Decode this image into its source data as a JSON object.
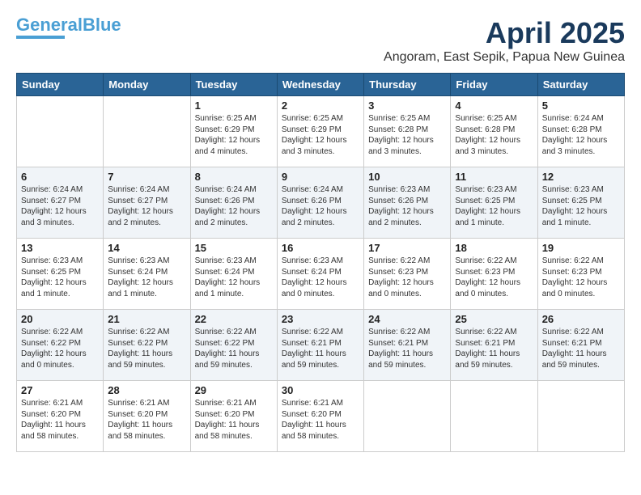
{
  "header": {
    "logo_line1": "General",
    "logo_line2": "Blue",
    "month": "April 2025",
    "location": "Angoram, East Sepik, Papua New Guinea"
  },
  "days_of_week": [
    "Sunday",
    "Monday",
    "Tuesday",
    "Wednesday",
    "Thursday",
    "Friday",
    "Saturday"
  ],
  "weeks": [
    [
      {
        "day": "",
        "content": ""
      },
      {
        "day": "",
        "content": ""
      },
      {
        "day": "1",
        "content": "Sunrise: 6:25 AM\nSunset: 6:29 PM\nDaylight: 12 hours\nand 4 minutes."
      },
      {
        "day": "2",
        "content": "Sunrise: 6:25 AM\nSunset: 6:29 PM\nDaylight: 12 hours\nand 3 minutes."
      },
      {
        "day": "3",
        "content": "Sunrise: 6:25 AM\nSunset: 6:28 PM\nDaylight: 12 hours\nand 3 minutes."
      },
      {
        "day": "4",
        "content": "Sunrise: 6:25 AM\nSunset: 6:28 PM\nDaylight: 12 hours\nand 3 minutes."
      },
      {
        "day": "5",
        "content": "Sunrise: 6:24 AM\nSunset: 6:28 PM\nDaylight: 12 hours\nand 3 minutes."
      }
    ],
    [
      {
        "day": "6",
        "content": "Sunrise: 6:24 AM\nSunset: 6:27 PM\nDaylight: 12 hours\nand 3 minutes."
      },
      {
        "day": "7",
        "content": "Sunrise: 6:24 AM\nSunset: 6:27 PM\nDaylight: 12 hours\nand 2 minutes."
      },
      {
        "day": "8",
        "content": "Sunrise: 6:24 AM\nSunset: 6:26 PM\nDaylight: 12 hours\nand 2 minutes."
      },
      {
        "day": "9",
        "content": "Sunrise: 6:24 AM\nSunset: 6:26 PM\nDaylight: 12 hours\nand 2 minutes."
      },
      {
        "day": "10",
        "content": "Sunrise: 6:23 AM\nSunset: 6:26 PM\nDaylight: 12 hours\nand 2 minutes."
      },
      {
        "day": "11",
        "content": "Sunrise: 6:23 AM\nSunset: 6:25 PM\nDaylight: 12 hours\nand 1 minute."
      },
      {
        "day": "12",
        "content": "Sunrise: 6:23 AM\nSunset: 6:25 PM\nDaylight: 12 hours\nand 1 minute."
      }
    ],
    [
      {
        "day": "13",
        "content": "Sunrise: 6:23 AM\nSunset: 6:25 PM\nDaylight: 12 hours\nand 1 minute."
      },
      {
        "day": "14",
        "content": "Sunrise: 6:23 AM\nSunset: 6:24 PM\nDaylight: 12 hours\nand 1 minute."
      },
      {
        "day": "15",
        "content": "Sunrise: 6:23 AM\nSunset: 6:24 PM\nDaylight: 12 hours\nand 1 minute."
      },
      {
        "day": "16",
        "content": "Sunrise: 6:23 AM\nSunset: 6:24 PM\nDaylight: 12 hours\nand 0 minutes."
      },
      {
        "day": "17",
        "content": "Sunrise: 6:22 AM\nSunset: 6:23 PM\nDaylight: 12 hours\nand 0 minutes."
      },
      {
        "day": "18",
        "content": "Sunrise: 6:22 AM\nSunset: 6:23 PM\nDaylight: 12 hours\nand 0 minutes."
      },
      {
        "day": "19",
        "content": "Sunrise: 6:22 AM\nSunset: 6:23 PM\nDaylight: 12 hours\nand 0 minutes."
      }
    ],
    [
      {
        "day": "20",
        "content": "Sunrise: 6:22 AM\nSunset: 6:22 PM\nDaylight: 12 hours\nand 0 minutes."
      },
      {
        "day": "21",
        "content": "Sunrise: 6:22 AM\nSunset: 6:22 PM\nDaylight: 11 hours\nand 59 minutes."
      },
      {
        "day": "22",
        "content": "Sunrise: 6:22 AM\nSunset: 6:22 PM\nDaylight: 11 hours\nand 59 minutes."
      },
      {
        "day": "23",
        "content": "Sunrise: 6:22 AM\nSunset: 6:21 PM\nDaylight: 11 hours\nand 59 minutes."
      },
      {
        "day": "24",
        "content": "Sunrise: 6:22 AM\nSunset: 6:21 PM\nDaylight: 11 hours\nand 59 minutes."
      },
      {
        "day": "25",
        "content": "Sunrise: 6:22 AM\nSunset: 6:21 PM\nDaylight: 11 hours\nand 59 minutes."
      },
      {
        "day": "26",
        "content": "Sunrise: 6:22 AM\nSunset: 6:21 PM\nDaylight: 11 hours\nand 59 minutes."
      }
    ],
    [
      {
        "day": "27",
        "content": "Sunrise: 6:21 AM\nSunset: 6:20 PM\nDaylight: 11 hours\nand 58 minutes."
      },
      {
        "day": "28",
        "content": "Sunrise: 6:21 AM\nSunset: 6:20 PM\nDaylight: 11 hours\nand 58 minutes."
      },
      {
        "day": "29",
        "content": "Sunrise: 6:21 AM\nSunset: 6:20 PM\nDaylight: 11 hours\nand 58 minutes."
      },
      {
        "day": "30",
        "content": "Sunrise: 6:21 AM\nSunset: 6:20 PM\nDaylight: 11 hours\nand 58 minutes."
      },
      {
        "day": "",
        "content": ""
      },
      {
        "day": "",
        "content": ""
      },
      {
        "day": "",
        "content": ""
      }
    ]
  ]
}
